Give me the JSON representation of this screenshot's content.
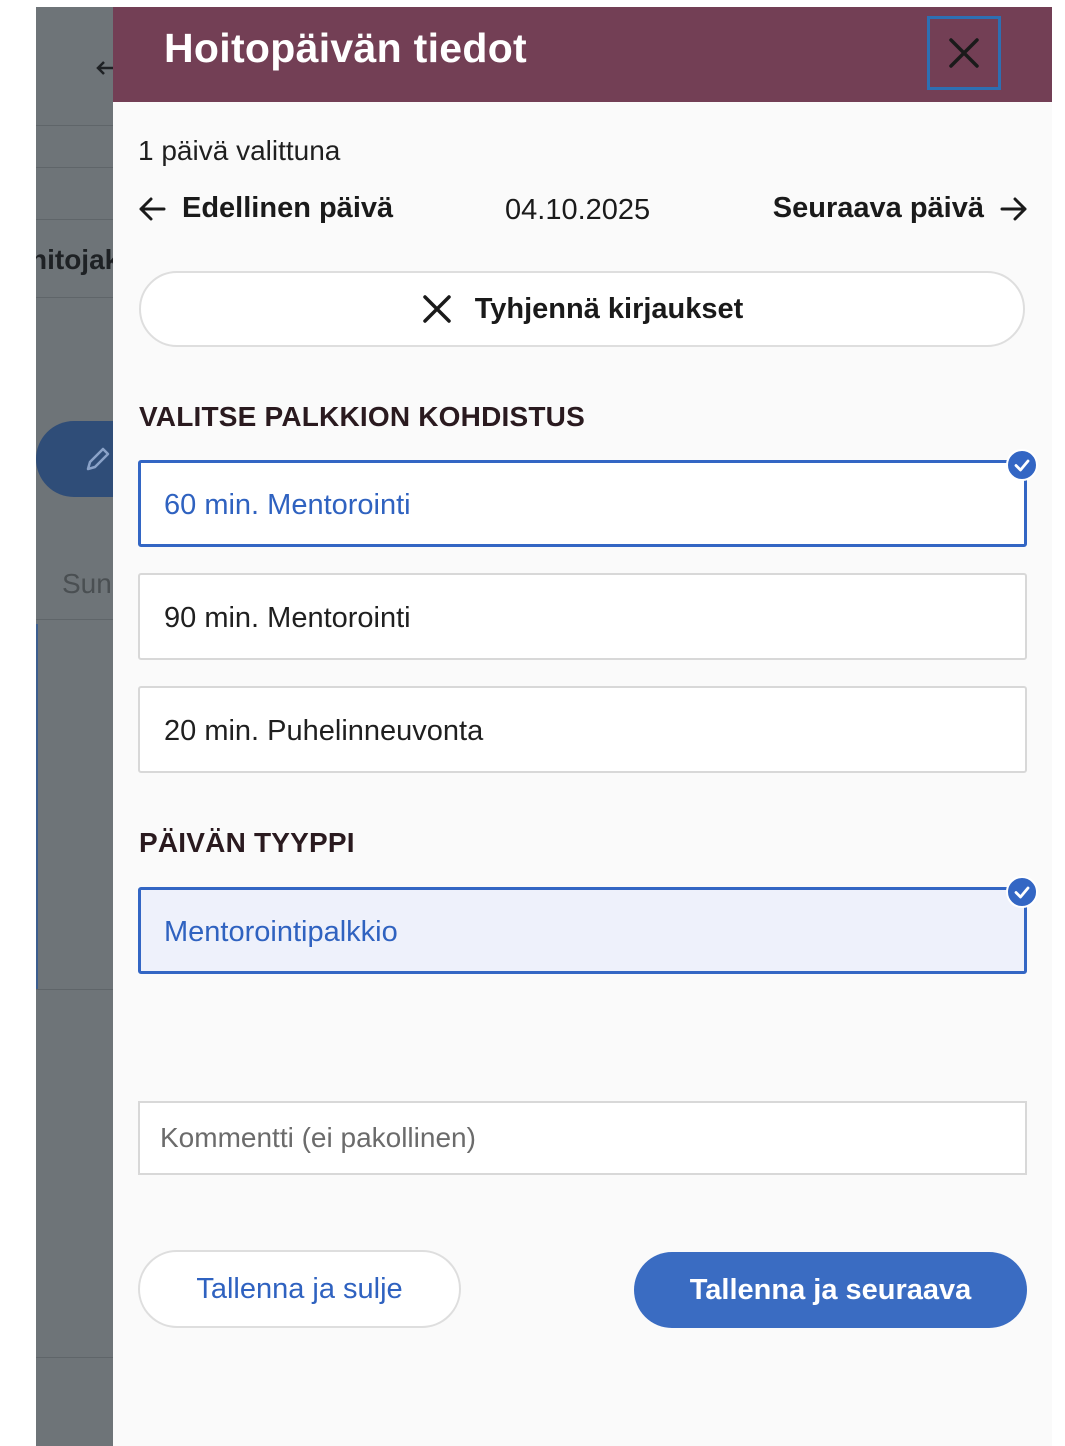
{
  "background": {
    "partial_title": "hitojak",
    "partial_sum": "Sun"
  },
  "panel": {
    "title": "Hoitopäivän tiedot",
    "close_icon": "close-icon",
    "selected_count": "1 päivä valittuna",
    "nav": {
      "prev_label": "Edellinen päivä",
      "date": "04.10.2025",
      "next_label": "Seuraava päivä"
    },
    "clear_button_label": "Tyhjennä kirjaukset",
    "reward_section": {
      "heading": "VALITSE PALKKION KOHDISTUS",
      "options": [
        {
          "label": "60 min. Mentorointi",
          "selected": true
        },
        {
          "label": "90 min. Mentorointi",
          "selected": false
        },
        {
          "label": "20 min. Puhelinneuvonta",
          "selected": false
        }
      ]
    },
    "day_type_section": {
      "heading": "PÄIVÄN TYYPPI",
      "options": [
        {
          "label": "Mentorointipalkkio",
          "selected": true
        }
      ]
    },
    "comment": {
      "placeholder": "Kommentti (ei pakollinen)",
      "value": ""
    },
    "buttons": {
      "save_close": "Tallenna ja sulje",
      "save_next": "Tallenna ja seuraava"
    }
  },
  "colors": {
    "header": "#733f55",
    "accent": "#3366c4",
    "primary_button": "#3a6cc2"
  }
}
